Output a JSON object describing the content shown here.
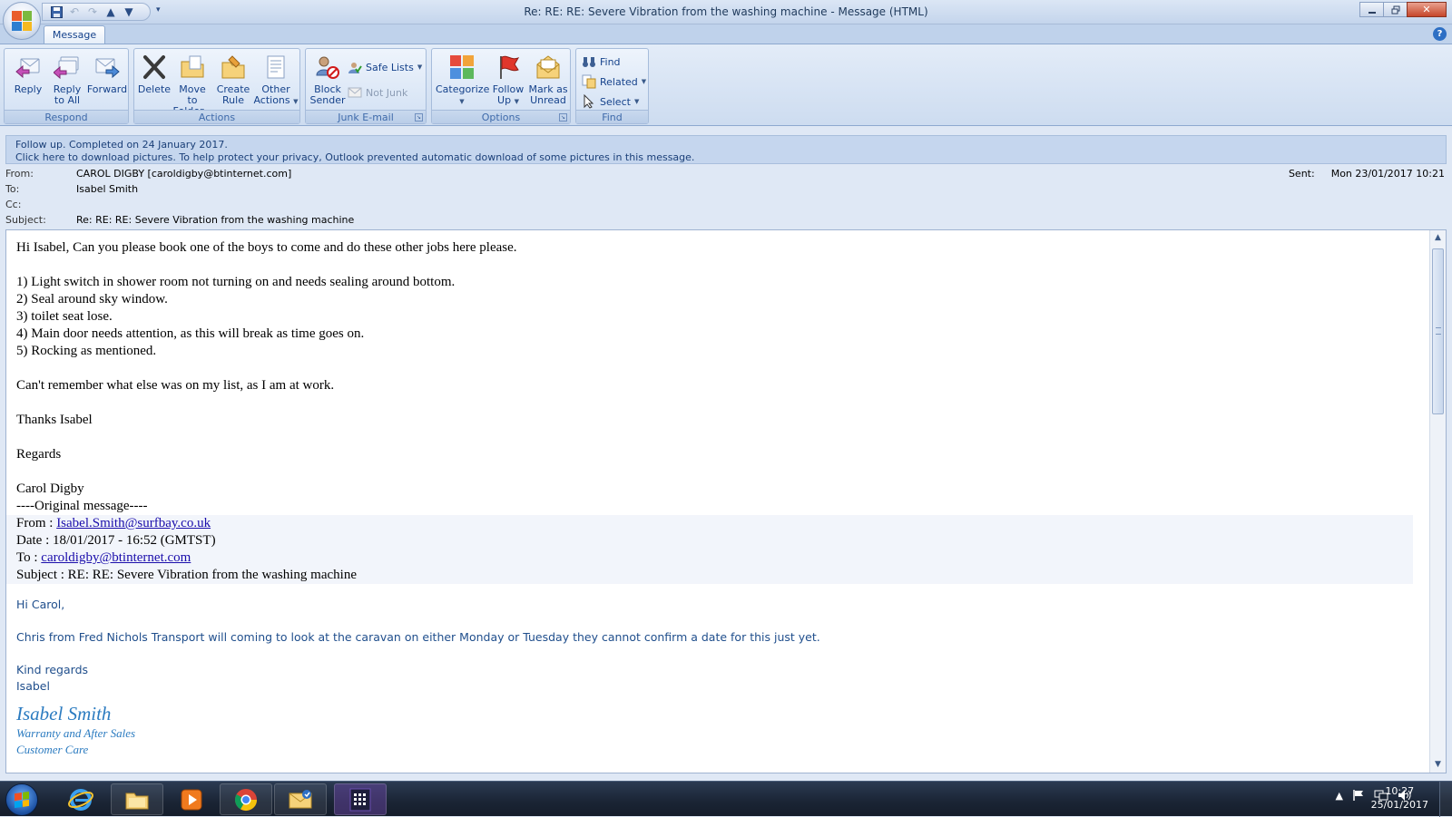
{
  "window": {
    "title": "Re: RE: RE: Severe Vibration from the washing machine - Message (HTML)"
  },
  "tabs": [
    {
      "label": "Message"
    }
  ],
  "ribbon": {
    "respond": {
      "label": "Respond",
      "reply": "Reply",
      "reply_all_1": "Reply",
      "reply_all_2": "to All",
      "forward": "Forward"
    },
    "actions": {
      "label": "Actions",
      "delete": "Delete",
      "move_1": "Move to",
      "move_2": "Folder",
      "rule_1": "Create",
      "rule_2": "Rule",
      "other_1": "Other",
      "other_2": "Actions"
    },
    "junk": {
      "label": "Junk E-mail",
      "block_1": "Block",
      "block_2": "Sender",
      "safe_lists": "Safe Lists",
      "not_junk": "Not Junk"
    },
    "options": {
      "label": "Options",
      "categorize": "Categorize",
      "follow_1": "Follow",
      "follow_2": "Up",
      "mark_1": "Mark as",
      "mark_2": "Unread"
    },
    "find": {
      "label": "Find",
      "find": "Find",
      "related": "Related",
      "select": "Select"
    }
  },
  "infobar": {
    "line1": "Follow up.  Completed on 24 January 2017.",
    "line2": "Click here to download pictures. To help protect your privacy, Outlook prevented automatic download of some pictures in this message."
  },
  "header": {
    "from_label": "From:",
    "from": "CAROL DIGBY [caroldigby@btinternet.com]",
    "to_label": "To:",
    "to": "Isabel Smith",
    "cc_label": "Cc:",
    "subject_label": "Subject:",
    "subject": "Re: RE: RE: Severe Vibration from the washing machine",
    "sent_label": "Sent:",
    "sent": "Mon 23/01/2017 10:21"
  },
  "body": {
    "greeting": "Hi Isabel, Can you please book one of the boys to come and do these other jobs here please.",
    "items": [
      "1)  Light switch in shower room not turning on and needs sealing around bottom.",
      "2)  Seal around sky window.",
      "3)  toilet seat lose.",
      "4)  Main door needs attention, as this will break as time goes on.",
      "5)  Rocking as mentioned."
    ],
    "cant_remember": "Can't remember what else was on my list, as I am at work.",
    "thanks": "Thanks Isabel",
    "regards": "Regards",
    "signoff": "Carol Digby",
    "original_marker": "----Original message----",
    "orig_from_label": "From : ",
    "orig_from": "Isabel.Smith@surfbay.co.uk",
    "orig_date": "Date : 18/01/2017 - 16:52 (GMTST)",
    "orig_to_label": "To : ",
    "orig_to": "caroldigby@btinternet.com",
    "orig_subject": "Subject : RE: RE: Severe Vibration from the washing machine",
    "reply_greeting": "Hi Carol,",
    "reply_text": "Chris from Fred Nichols Transport will coming to look at the caravan on either Monday or Tuesday they cannot confirm a date for this just yet.",
    "kind_regards": "Kind regards",
    "reply_name": "Isabel",
    "sig_name": "Isabel Smith",
    "sig_line1": "Warranty and After Sales",
    "sig_line2": "Customer Care"
  },
  "taskbar": {
    "time": "10:27",
    "date": "25/01/2017"
  },
  "colors": {
    "ribbon_text": "#15428b",
    "signature": "#2b7bc0",
    "link": "#1a0dab"
  }
}
